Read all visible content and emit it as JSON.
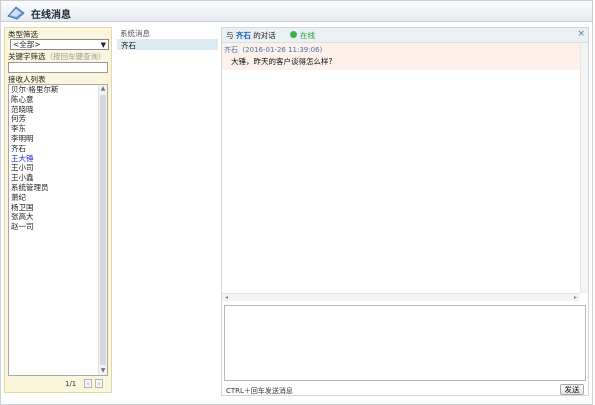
{
  "window": {
    "title": "在线消息"
  },
  "filters": {
    "type_label": "类型筛选",
    "type_selected": "<全部>",
    "keyword_label": "关键字筛选",
    "keyword_hint": "（按回车键查询）",
    "keyword_value": "",
    "recipients_label": "接收人列表",
    "recipients": [
      "贝尔·格里尔斯",
      "陈心意",
      "范晓晓",
      "何芳",
      "李东",
      "李明明",
      "齐石",
      "王大锤",
      "王小司",
      "王小鑫",
      "系统管理员",
      "萧纪",
      "杨卫国",
      "张高大",
      "赵一司"
    ],
    "selected_recipient": "王大锤",
    "pager": "1/1"
  },
  "conversations": {
    "header": "系统消息",
    "items": [
      {
        "name": "齐石",
        "active": true
      }
    ]
  },
  "chat": {
    "prefix": "与",
    "partner": "齐石",
    "suffix": "的对话",
    "status": "在线",
    "close_icon": "×",
    "message": {
      "sender": "齐石",
      "time": "(2016-01-26 11:39:06)",
      "text": "大锤，昨天的客户谈得怎么样?"
    },
    "input_value": "",
    "send_hint": "CTRL＋回车发送消息",
    "send_label": "发送"
  },
  "colors": {
    "online": "#3ab34a",
    "link": "#1a5fb4",
    "selected_item": "#2233cc"
  }
}
